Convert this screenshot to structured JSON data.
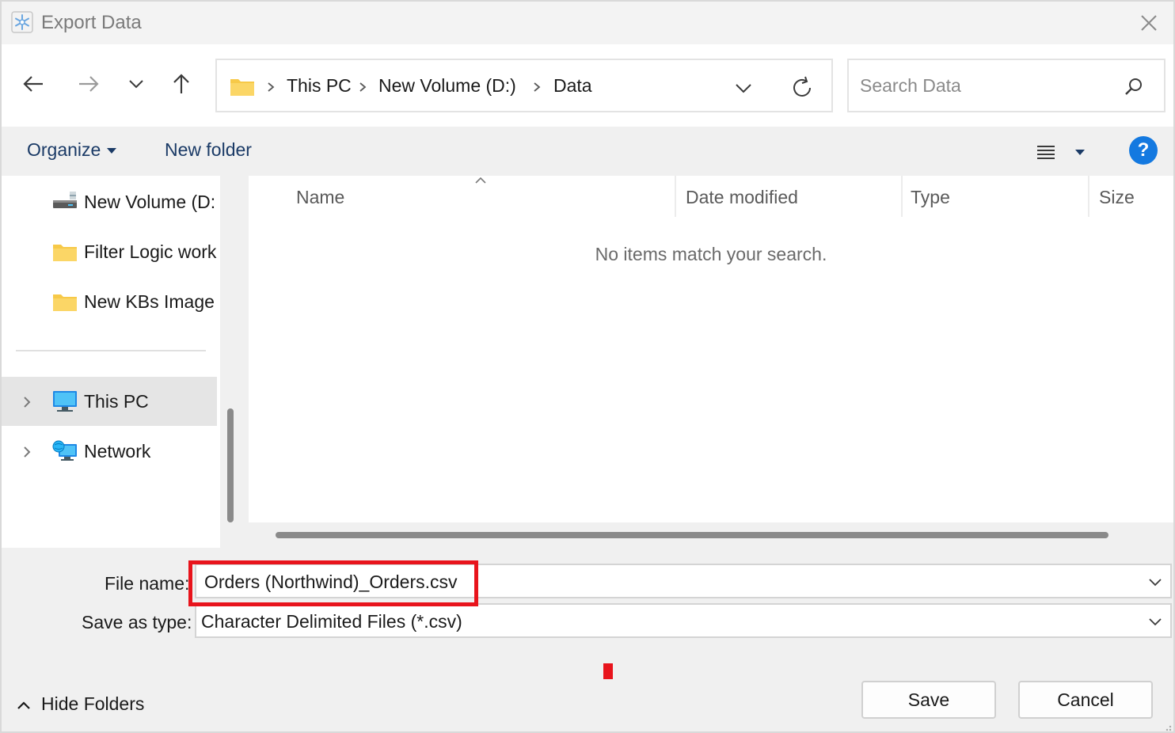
{
  "window": {
    "title": "Export Data",
    "icon": "snowflake-icon"
  },
  "nav": {
    "back_icon": "arrow-left-icon",
    "forward_icon": "arrow-right-icon",
    "recent_icon": "chevron-down-icon",
    "up_icon": "arrow-up-icon"
  },
  "address": {
    "crumbs": [
      "This PC",
      "New Volume (D:)",
      "Data"
    ],
    "refresh_icon": "refresh-icon"
  },
  "search": {
    "placeholder": "Search Data",
    "value": ""
  },
  "toolbar": {
    "organize_label": "Organize",
    "new_folder_label": "New folder",
    "help_label": "?"
  },
  "sidebar": {
    "items": [
      {
        "label": "New Volume (D:",
        "icon": "drive-icon"
      },
      {
        "label": "Filter Logic work",
        "icon": "folder-icon"
      },
      {
        "label": "New KBs Image",
        "icon": "folder-icon"
      },
      {
        "label": "This PC",
        "icon": "computer-icon",
        "selected": true
      },
      {
        "label": "Network",
        "icon": "network-icon"
      }
    ]
  },
  "filelist": {
    "columns": [
      "Name",
      "Date modified",
      "Type",
      "Size"
    ],
    "empty_message": "No items match your search."
  },
  "form": {
    "file_name_label": "File name:",
    "file_name_value": "Orders (Northwind)_Orders.csv",
    "save_type_label": "Save as type:",
    "save_type_value": "Character Delimited Files (*.csv)"
  },
  "footer": {
    "hide_folders_label": "Hide Folders",
    "save_label": "Save",
    "cancel_label": "Cancel"
  },
  "colors": {
    "accent": "#1479e0",
    "highlight": "#e8141c",
    "folder": "#f7c948"
  }
}
